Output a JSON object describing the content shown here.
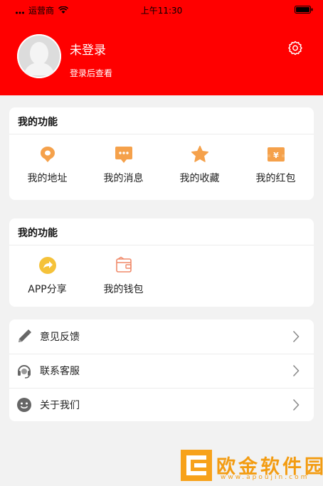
{
  "status_bar": {
    "carrier": "运营商",
    "time": "上午11:30"
  },
  "profile": {
    "name": "未登录",
    "subtitle": "登录后查看"
  },
  "section_functions": {
    "title": "我的功能",
    "items": [
      {
        "label": "我的地址",
        "icon": "location-icon",
        "color": "#f5a14b"
      },
      {
        "label": "我的消息",
        "icon": "message-icon",
        "color": "#f5a14b"
      },
      {
        "label": "我的收藏",
        "icon": "star-icon",
        "color": "#f5a14b"
      },
      {
        "label": "我的红包",
        "icon": "red-envelope-icon",
        "color": "#f5a14b"
      }
    ]
  },
  "section_functions_2": {
    "title": "我的功能",
    "items": [
      {
        "label": "APP分享",
        "icon": "share-icon",
        "color": "#f5c23a"
      },
      {
        "label": "我的钱包",
        "icon": "wallet-icon",
        "color": "#f08a6a"
      }
    ]
  },
  "settings_list": [
    {
      "label": "意见反馈",
      "icon": "pencil-icon"
    },
    {
      "label": "联系客服",
      "icon": "headset-icon"
    },
    {
      "label": "关于我们",
      "icon": "smiley-icon"
    }
  ],
  "watermark": {
    "text": "欧金软件园",
    "url": "www.apoujin.com"
  },
  "colors": {
    "header_red": "#ff0000",
    "accent_orange": "#f5a14b",
    "background": "#f2f2f2"
  }
}
